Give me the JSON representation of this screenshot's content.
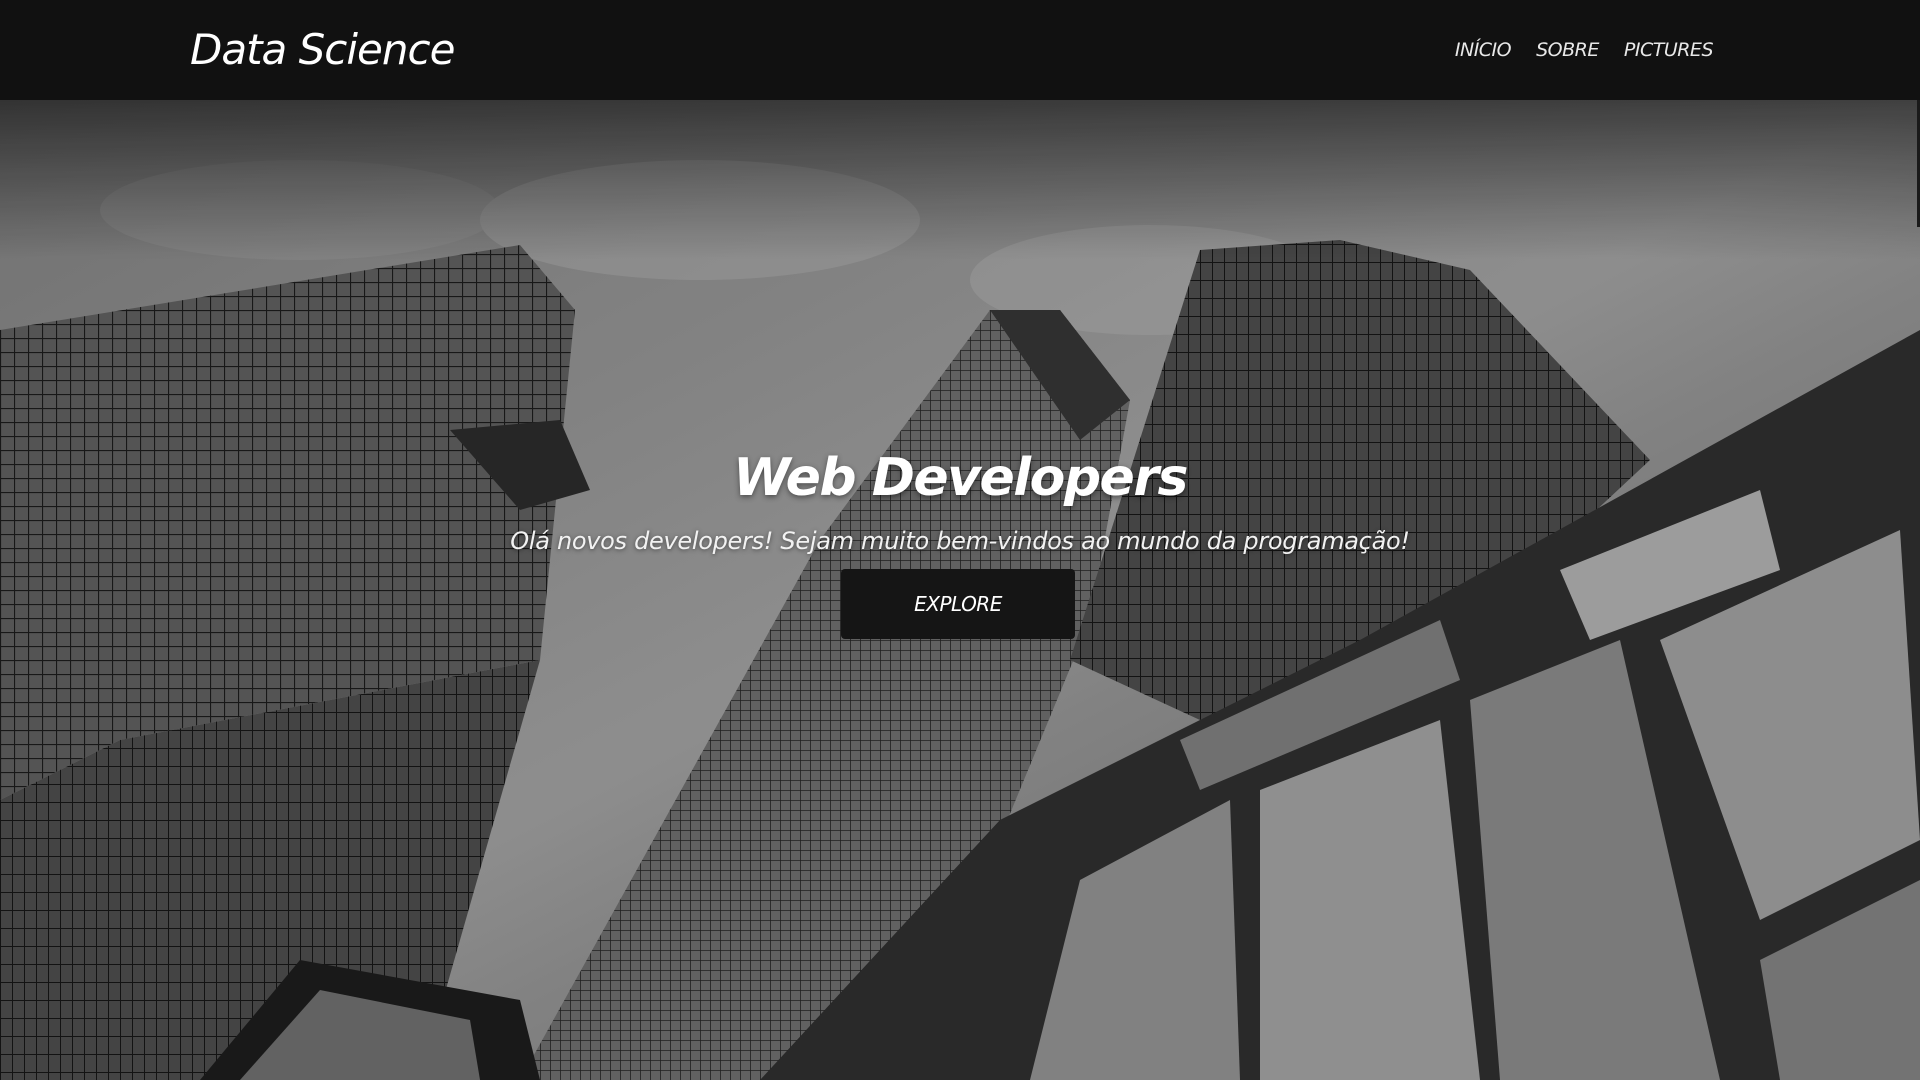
{
  "navbar": {
    "brand": "Data Science",
    "links": [
      {
        "label": "INÍCIO"
      },
      {
        "label": "SOBRE"
      },
      {
        "label": "PICTURES"
      }
    ]
  },
  "hero": {
    "title": "Web Developers",
    "subtitle": "Olá novos developers! Sejam muito bem-vindos ao mundo da programação!",
    "button_label": "EXPLORE",
    "background": "grayscale-skyscrapers-photo"
  },
  "colors": {
    "navbar_bg": "#111111",
    "button_bg": "#151515",
    "text": "#ffffff"
  }
}
